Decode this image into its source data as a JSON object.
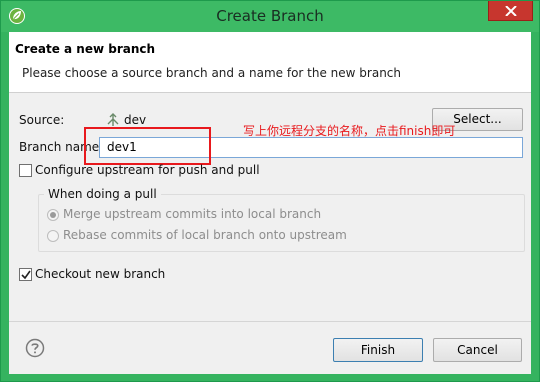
{
  "window": {
    "title": "Create Branch",
    "app_icon": "spring-leaf-icon",
    "close_icon": "close-icon"
  },
  "header": {
    "title": "Create a new branch",
    "description": "Please choose a source branch and a name for the new branch"
  },
  "form": {
    "source_label": "Source:",
    "source_branch": "dev",
    "source_icon": "git-branch-icon",
    "select_label": "Select...",
    "branch_name_label": "Branch name:",
    "branch_name_value": "dev1",
    "configure_upstream_label": "Configure upstream for push and pull",
    "configure_upstream_checked": false,
    "pull_group_title": "When doing a pull",
    "merge_label": "Merge upstream commits into local branch",
    "merge_selected": true,
    "rebase_label": "Rebase commits of local branch onto upstream",
    "rebase_selected": false,
    "checkout_label": "Checkout new branch",
    "checkout_checked": true
  },
  "annotation": {
    "text": "写上你远程分支的名称，点击finish即可",
    "color": "#e8191d"
  },
  "footer": {
    "help_icon": "help-icon",
    "finish_label": "Finish",
    "cancel_label": "Cancel"
  },
  "colors": {
    "title_bar": "#3dba65",
    "close_button": "#c7362e",
    "dialog_bg": "#f0f0f0"
  }
}
